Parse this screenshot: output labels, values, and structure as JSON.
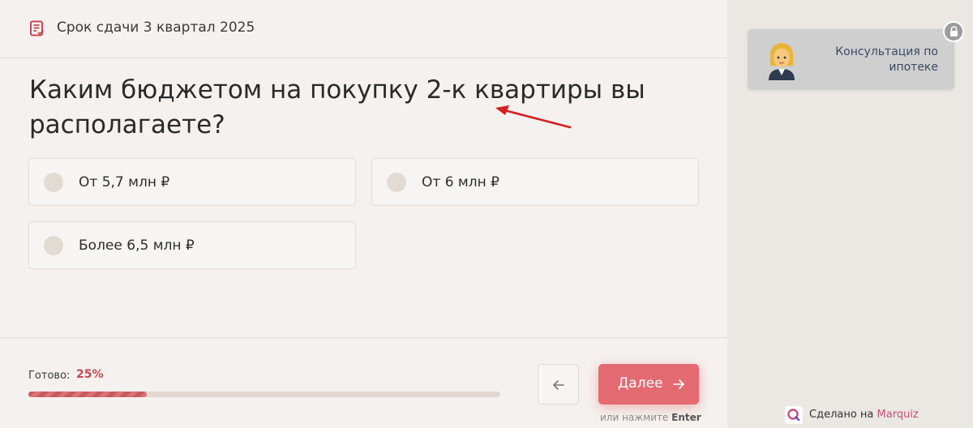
{
  "header": {
    "deadline": "Срок сдачи 3 квартал 2025"
  },
  "question": {
    "title": "Каким бюджетом на покупку 2-к квартиры вы располагаете?"
  },
  "options": [
    {
      "label": "От 5,7 млн ₽"
    },
    {
      "label": "От 6 млн ₽"
    },
    {
      "label": "Более 6,5 млн ₽"
    }
  ],
  "progress": {
    "label": "Готово:",
    "value_text": "25%",
    "fraction": 0.25
  },
  "navigation": {
    "next_label": "Далее",
    "hint_prefix": "или нажмите",
    "hint_key": "Enter"
  },
  "sidebar": {
    "consult_label": "Консультация по ипотеке",
    "made_with_prefix": "Сделано на",
    "made_with_brand": "Marquiz"
  },
  "colors": {
    "accent": "#e46a71",
    "progress_text": "#c9474f",
    "brand": "#c74f77",
    "annotation_arrow": "#d42020"
  },
  "icons": [
    "document-icon",
    "radio-icon",
    "arrow-left-icon",
    "arrow-right-icon",
    "lock-icon",
    "avatar-icon",
    "marquiz-logo-icon",
    "annotation-arrow-icon"
  ]
}
